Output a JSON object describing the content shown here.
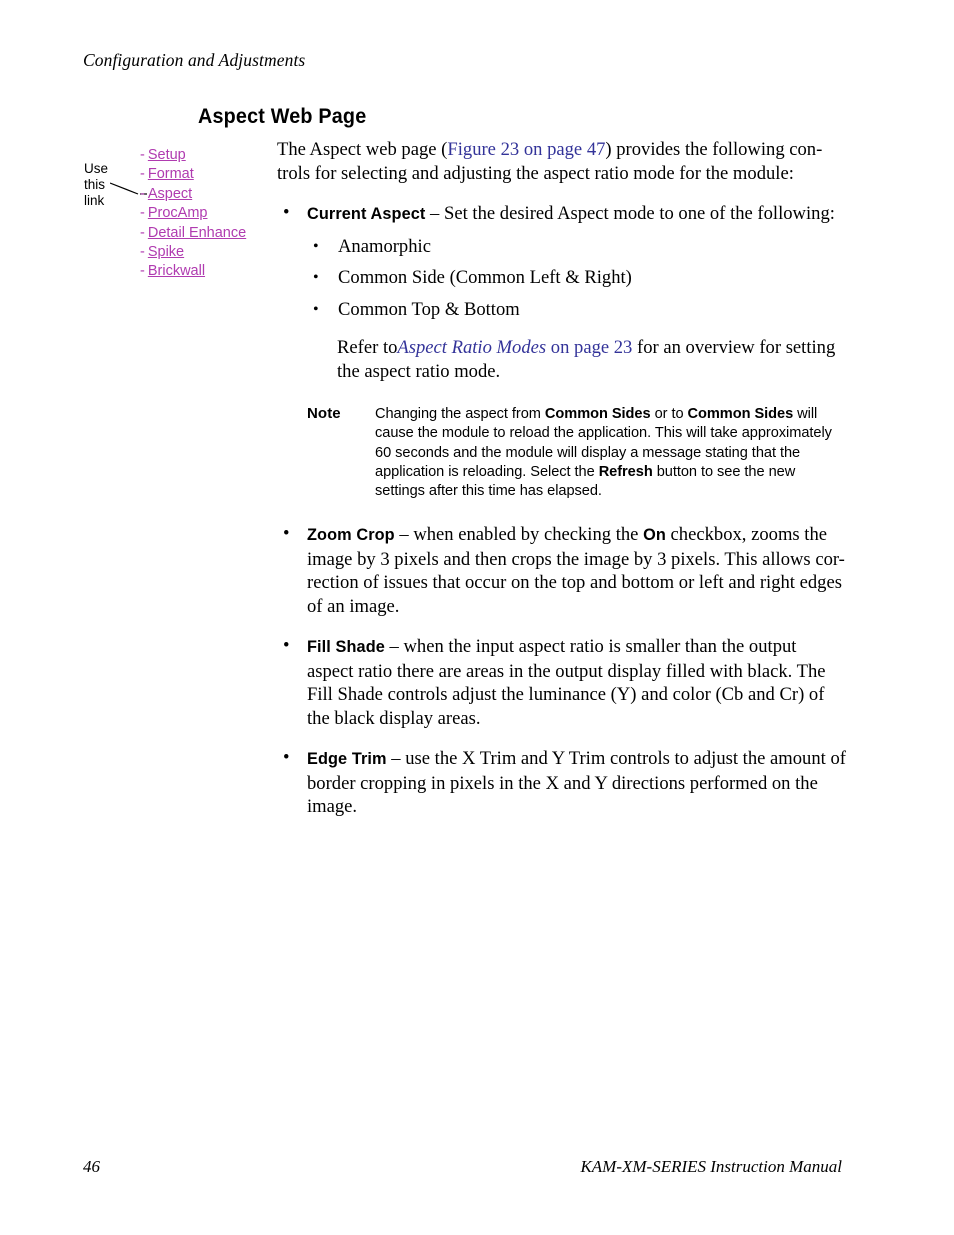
{
  "page": {
    "running_header": "Configuration and Adjustments",
    "footer_page_number": "46",
    "footer_title": "KAM-XM-SERIES Instruction Manual"
  },
  "colors": {
    "weblink": "#b03bb0",
    "crossref": "#333399",
    "text": "#000000",
    "background": "#ffffff"
  },
  "heading": {
    "title": "Aspect Web Page"
  },
  "callout": {
    "line1": "Use",
    "line2": "this",
    "line3": "link",
    "target": "Aspect"
  },
  "weblinks": {
    "dash": "-",
    "items": [
      {
        "label": "Setup"
      },
      {
        "label": "Format"
      },
      {
        "label": "Aspect"
      },
      {
        "label": "ProcAmp"
      },
      {
        "label": "Detail Enhance"
      },
      {
        "label": "Spike"
      },
      {
        "label": "Brickwall"
      }
    ]
  },
  "intro": {
    "part1": "The Aspect web page (",
    "link": "Figure 23 on page 47",
    "part2": ") provides the following con-trols for selecting and adjusting the aspect ratio mode for the module:"
  },
  "bullets": {
    "current_aspect": {
      "term": "Current Aspect",
      "text": " – Set the desired Aspect mode to one of the following:",
      "options": [
        "Anamorphic",
        "Common Side (Common Left & Right)",
        "Common Top & Bottom"
      ],
      "refer_prefix": "Refer to",
      "refer_link_italic": "Aspect Ratio Modes",
      "refer_link_rest": " on page 23",
      "refer_suffix": " for an overview for setting the aspect ratio mode."
    },
    "zoom_crop": {
      "term": "Zoom Crop",
      "text_a": " – when enabled by checking the ",
      "emphasis": "On",
      "text_b": " checkbox, zooms the image by 3 pixels and then crops the image by 3 pixels. This allows cor-rection of issues that occur on the top and bottom or left and right edges of an image."
    },
    "fill_shade": {
      "term": "Fill Shade",
      "text": " – when the input aspect ratio is smaller than the output aspect ratio there are areas in the output display filled with black. The Fill Shade controls adjust the luminance (Y) and color (Cb and Cr) of the black display areas."
    },
    "edge_trim": {
      "term": "Edge Trim",
      "text": " – use the X Trim and Y Trim controls to adjust the amount of border cropping in pixels in the X and Y directions performed on the image."
    }
  },
  "note": {
    "label": "Note",
    "seg1": "Changing the aspect from ",
    "bold1": "Common Sides",
    "seg2": " or to ",
    "bold2": "Common Sides",
    "seg3": " will cause the module to reload the application. This will take approximately 60 seconds and the module will display a message stating that the application is reloading. Select the ",
    "bold3": "Refresh",
    "seg4": " button to see the new settings after this time has elapsed."
  }
}
